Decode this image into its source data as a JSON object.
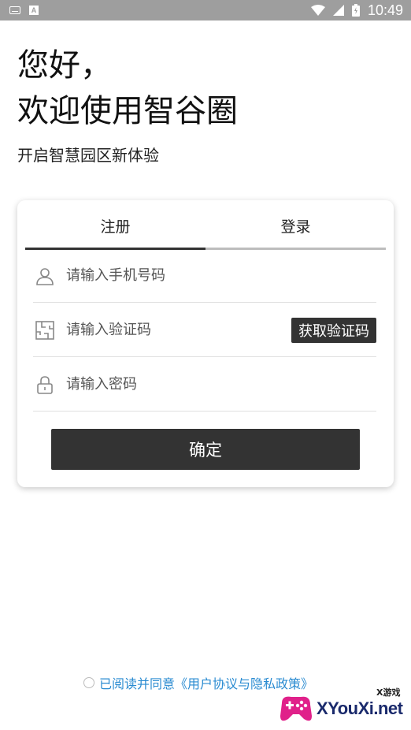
{
  "status_bar": {
    "time": "10:49",
    "left_icons": [
      "keyboard-icon",
      "a-box-icon"
    ],
    "right_icons": [
      "wifi-icon",
      "signal-icon",
      "battery-icon"
    ],
    "background": "#9e9e9e"
  },
  "greeting": {
    "line1": "您好，",
    "line2": "欢迎使用智谷圈",
    "subtitle": "开启智慧园区新体验"
  },
  "tabs": [
    {
      "label": "注册",
      "active": true
    },
    {
      "label": "登录",
      "active": false
    }
  ],
  "form": {
    "phone": {
      "placeholder": "请输入手机号码",
      "value": "",
      "icon": "user-icon"
    },
    "code": {
      "placeholder": "请输入验证码",
      "value": "",
      "icon": "puzzle-icon",
      "button_label": "获取验证码"
    },
    "password": {
      "placeholder": "请输入密码",
      "value": "",
      "icon": "lock-icon"
    },
    "submit_label": "确定"
  },
  "agreement": {
    "text": "已阅读并同意《用户协议与隐私政策》",
    "checked": false,
    "color": "#2a8bd1"
  },
  "watermark": {
    "text": "XYouXi.net",
    "small": "X游戏"
  },
  "colors": {
    "primary_button": "#333333",
    "tab_indicator": "#333333",
    "tab_track": "#bdbdbd"
  }
}
